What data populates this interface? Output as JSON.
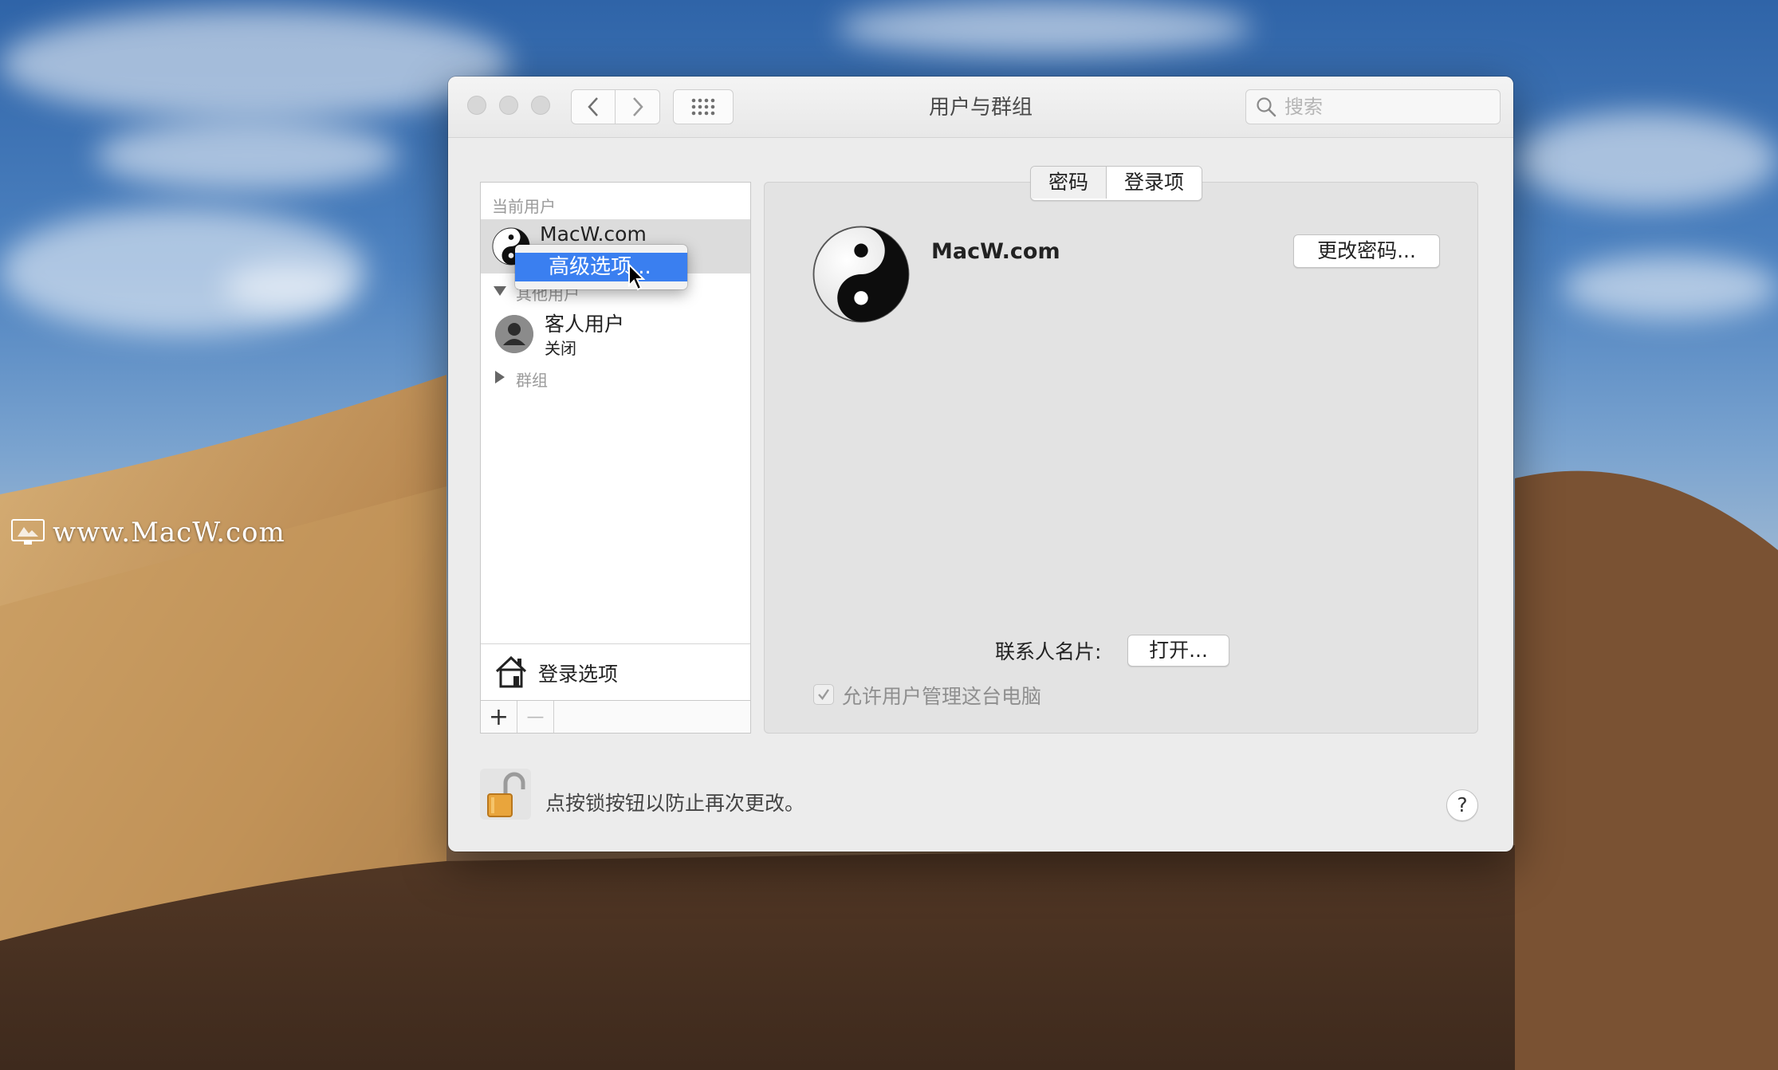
{
  "desktop": {
    "watermark": "www.MacW.com"
  },
  "window": {
    "title": "用户与群组"
  },
  "search": {
    "placeholder": "搜索"
  },
  "sidebar": {
    "current_users_label": "当前用户",
    "current_user_name": "MacW.com",
    "other_users_label": "其他用户",
    "guest_name": "客人用户",
    "guest_status": "关闭",
    "groups_label": "群组",
    "login_options_label": "登录选项",
    "add_button": "+",
    "remove_button": "—"
  },
  "context_menu": {
    "item": "高级选项..."
  },
  "tabs": [
    {
      "label": "密码"
    },
    {
      "label": "登录项"
    }
  ],
  "detail": {
    "user_name": "MacW.com",
    "change_password_button": "更改密码...",
    "contact_card_label": "联系人名片:",
    "open_button": "打开...",
    "allow_admin_label": "允许用户管理这台电脑"
  },
  "footer": {
    "lock_text": "点按锁按钮以防止再次更改。",
    "help_button": "?"
  }
}
